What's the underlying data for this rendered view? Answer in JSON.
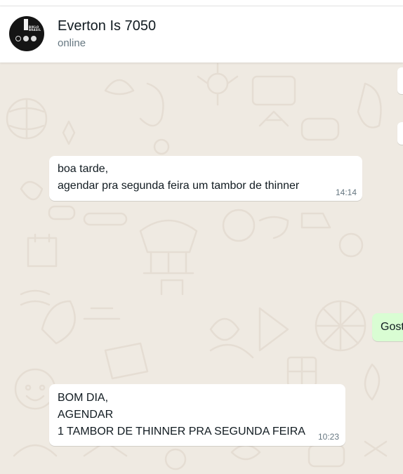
{
  "header": {
    "contact_name": "Everton Is 7050",
    "status": "online",
    "avatar_icon": "avatar-logo-icon",
    "avatar_brand": [
      "BIKLO",
      "BRASIL"
    ]
  },
  "messages": [
    {
      "direction": "incoming",
      "lines": [
        "boa tarde,",
        "agendar pra segunda feira um tambor de thinner"
      ],
      "time": "14:14"
    },
    {
      "direction": "outgoing",
      "lines": [
        "Gost"
      ],
      "time": ""
    },
    {
      "direction": "incoming",
      "lines": [
        "BOM DIA,",
        "AGENDAR",
        "1 TAMBOR DE THINNER PRA SEGUNDA FEIRA"
      ],
      "time": "10:23"
    }
  ],
  "colors": {
    "chat_background": "#efeae2",
    "incoming_bubble": "#ffffff",
    "outgoing_bubble": "#d9fdd3",
    "primary_text": "#111b21",
    "secondary_text": "#667781"
  }
}
